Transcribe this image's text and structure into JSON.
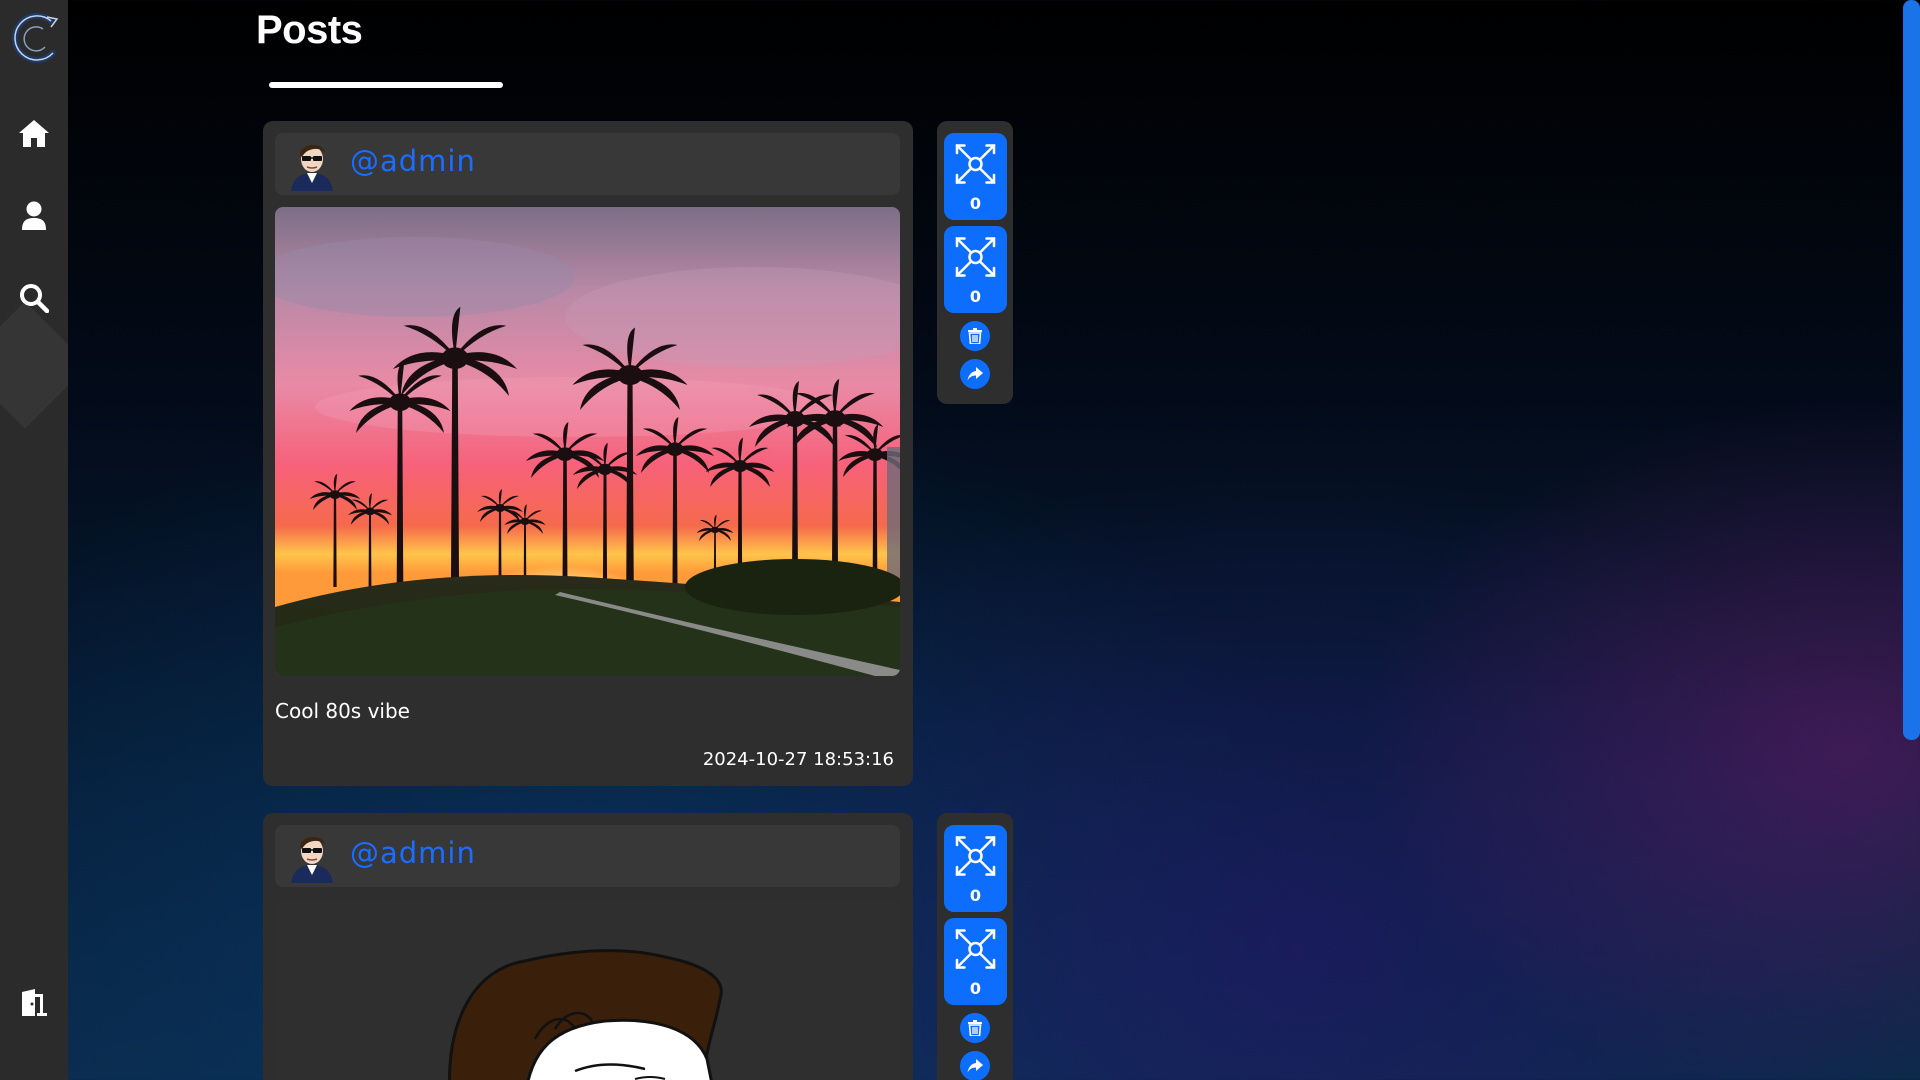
{
  "page": {
    "title": "Posts"
  },
  "sidebar": {
    "items": [
      {
        "icon": "logo-icon"
      },
      {
        "icon": "home-icon"
      },
      {
        "icon": "profile-icon"
      },
      {
        "icon": "search-icon"
      },
      {
        "icon": "logout-icon"
      }
    ]
  },
  "posts": [
    {
      "username": "@admin",
      "caption": "Cool 80s vibe",
      "timestamp": "2024-10-27 18:53:16",
      "reaction1_count": "0",
      "reaction2_count": "0",
      "image": "sunset-palm-trees-image"
    },
    {
      "username": "@admin",
      "caption": "",
      "timestamp": "",
      "reaction1_count": "0",
      "reaction2_count": "0",
      "image": "cartoon-face-image"
    }
  ],
  "colors": {
    "accent": "#0d6efd",
    "username": "#1a6dff",
    "card": "#2e2e2e",
    "sidebar": "#2b2b2b"
  }
}
